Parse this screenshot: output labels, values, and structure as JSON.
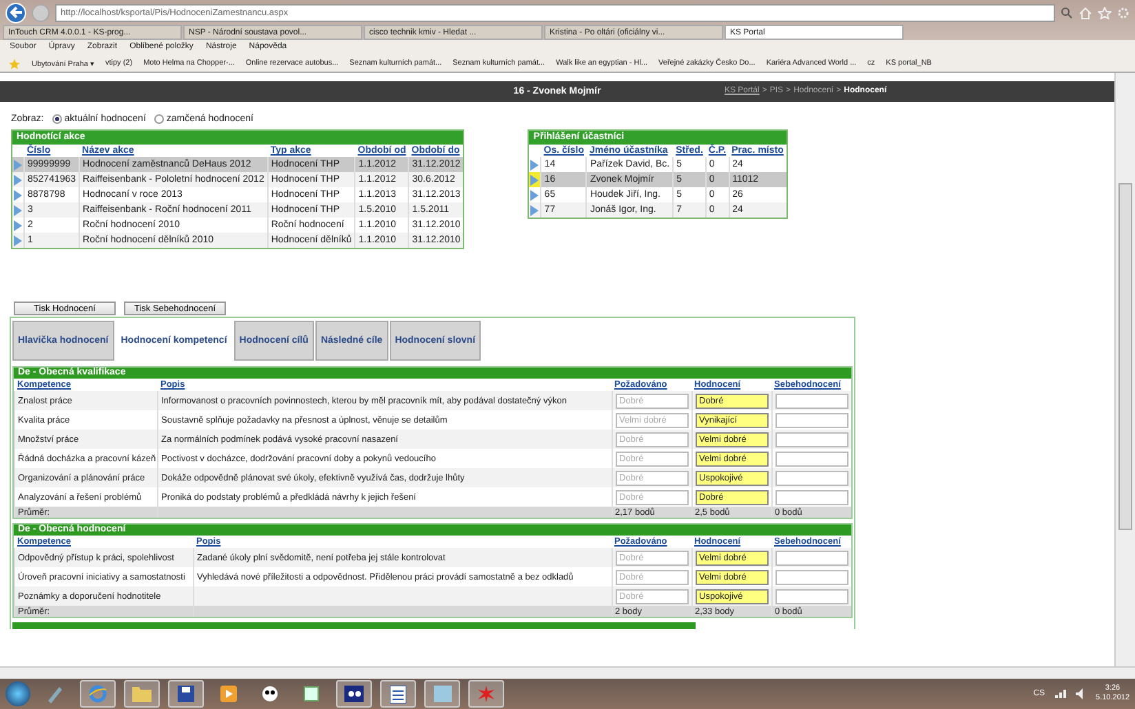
{
  "browser": {
    "address": "http://localhost/ksportal/Pis/HodnoceniZamestnancu.aspx",
    "tabs": [
      {
        "label": "InTouch CRM 4.0.0.1 - KS-prog...",
        "selected": false
      },
      {
        "label": "NSP - Národní soustava povol...",
        "selected": false
      },
      {
        "label": "cisco technik kmiv - Hledat ...",
        "selected": false
      },
      {
        "label": "Kristina - Po oltári (oficiálny vi...",
        "selected": false
      },
      {
        "label": "KS Portal",
        "selected": true
      }
    ],
    "menu": [
      "Soubor",
      "Úpravy",
      "Zobrazit",
      "Oblíbené položky",
      "Nástroje",
      "Nápověda"
    ],
    "favorites": [
      "Ubytování Praha ▾",
      "vtipy (2)",
      "Moto Helma na Chopper-...",
      "Online rezervace autobus...",
      "Seznam kulturních památ...",
      "Seznam kulturních památ...",
      "Walk like an egyptian - Hl...",
      "Veřejné zakázky Česko Do...",
      "Kariéra  Advanced World ...",
      "cz",
      "KS portal_NB"
    ]
  },
  "header": {
    "title": "16 - Zvonek Mojmír",
    "breadcrumb": [
      "KS Portál",
      "PIS",
      "Hodnocení",
      "Hodnocení"
    ],
    "separator": ">"
  },
  "filter": {
    "label": "Zobraz:",
    "options": [
      {
        "label": "aktuální hodnocení",
        "selected": true
      },
      {
        "label": "zamčená hodnocení",
        "selected": false
      }
    ]
  },
  "actions": {
    "title": "Hodnotící akce",
    "columns": [
      "Číslo",
      "Název akce",
      "Typ akce",
      "Období od",
      "Období do"
    ],
    "rows": [
      {
        "cells": [
          "99999999",
          "Hodnocení zaměstnanců DeHaus 2012",
          "Hodnocení THP",
          "1.1.2012",
          "31.12.2012"
        ],
        "selected": true
      },
      {
        "cells": [
          "852741963",
          "Raiffeisenbank - Pololetní hodnocení 2012",
          "Hodnocení THP",
          "1.1.2012",
          "30.6.2012"
        ],
        "selected": false
      },
      {
        "cells": [
          "8878798",
          "Hodnocaní v roce 2013",
          "Hodnocení THP",
          "1.1.2013",
          "31.12.2013"
        ],
        "selected": false
      },
      {
        "cells": [
          "3",
          "Raiffeisenbank - Roční hodnocení 2011",
          "Hodnocení THP",
          "1.5.2010",
          "1.5.2011"
        ],
        "selected": false
      },
      {
        "cells": [
          "2",
          "Roční hodnocení 2010",
          "Roční hodnocení",
          "1.1.2010",
          "31.12.2010"
        ],
        "selected": false
      },
      {
        "cells": [
          "1",
          "Roční hodnocení dělníků 2010",
          "Hodnocení dělníků",
          "1.1.2010",
          "31.12.2010"
        ],
        "selected": false
      }
    ]
  },
  "participants": {
    "title": "Přihlášení účastníci",
    "columns": [
      "Os. číslo",
      "Jméno účastníka",
      "Střed.",
      "Č.P.",
      "Prac. místo"
    ],
    "rows": [
      {
        "cells": [
          "14",
          "Pařízek David, Bc.",
          "5",
          "0",
          "24"
        ],
        "selected": false
      },
      {
        "cells": [
          "16",
          "Zvonek Mojmír",
          "5",
          "0",
          "11012"
        ],
        "selected": true
      },
      {
        "cells": [
          "65",
          "Houdek Jiří, Ing.",
          "5",
          "0",
          "26"
        ],
        "selected": false
      },
      {
        "cells": [
          "77",
          "Jonáš Igor, Ing.",
          "7",
          "0",
          "24"
        ],
        "selected": false
      }
    ]
  },
  "buttons": [
    "Tisk Hodnocení",
    "Tisk Sebehodnocení"
  ],
  "tabs": [
    {
      "label": "Hlavička hodnocení",
      "selected": false
    },
    {
      "label": "Hodnocení kompetencí",
      "selected": true
    },
    {
      "label": "Hodnocení cílů",
      "selected": false
    },
    {
      "label": "Následné cíle",
      "selected": false
    },
    {
      "label": "Hodnocení slovní",
      "selected": false
    }
  ],
  "sections": [
    {
      "title": "De - Obecná kvalifikace",
      "columns": [
        "Kompetence",
        "Popis",
        "Požadováno",
        "Hodnocení",
        "Sebehodnocení"
      ],
      "rows": [
        {
          "name": "Znalost práce",
          "description": "Informovanost o pracovních povinnostech, kterou by měl pracovník mít, aby podával dostatečný výkon",
          "required": "Dobré",
          "rating": "Dobré"
        },
        {
          "name": "Kvalita práce",
          "description": "Soustavně splňuje požadavky na přesnost a úplnost, věnuje se detailům",
          "required": "Velmi dobré",
          "rating": "Vynikající"
        },
        {
          "name": "Množství práce",
          "description": "Za normálních podmínek podává vysoké pracovní nasazení",
          "required": "Dobré",
          "rating": "Velmi dobré"
        },
        {
          "name": "Řádná docházka a pracovní kázeň",
          "description": "Poctivost v docházce, dodržování pracovní doby a pokynů vedoucího",
          "required": "Dobré",
          "rating": "Velmi dobré"
        },
        {
          "name": "Organizování a plánování práce",
          "description": "Dokáže odpovědně plánovat své úkoly, efektivně využívá čas, dodržuje lhůty",
          "required": "Dobré",
          "rating": "Uspokojivé"
        },
        {
          "name": "Analyzování a řešení problémů",
          "description": "Proniká do podstaty problémů a předkládá návrhy k jejich řešení",
          "required": "Dobré",
          "rating": "Dobré"
        }
      ],
      "average": {
        "label": "Průměr:",
        "required": "2,17 bodů",
        "rating": "2,5 bodů",
        "self": "0 bodů"
      }
    },
    {
      "title": "De - Obecná hodnocení",
      "columns": [
        "Kompetence",
        "Popis",
        "Požadováno",
        "Hodnocení",
        "Sebehodnocení"
      ],
      "rows": [
        {
          "name": "Odpovědný přístup k práci, spolehlivost",
          "description": "Zadané úkoly plní svědomitě, není potřeba jej stále kontrolovat",
          "required": "Dobré",
          "rating": "Velmi dobré"
        },
        {
          "name": "Úroveň pracovní iniciativy a samostatnosti",
          "description": "Vyhledává nové příležitosti a odpovědnost. Přidělenou práci provádí samostatně a bez odkladů",
          "required": "Dobré",
          "rating": "Velmi dobré"
        },
        {
          "name": "Poznámky a doporučení hodnotitele",
          "description": "",
          "required": "Dobré",
          "rating": "Uspokojivé"
        }
      ],
      "average": {
        "label": "Průměr:",
        "required": "2 body",
        "rating": "2,33 body",
        "self": "0 bodů"
      }
    }
  ],
  "taskbar": {
    "language": "CS",
    "time": "3:26",
    "date": "5.10.2012"
  }
}
